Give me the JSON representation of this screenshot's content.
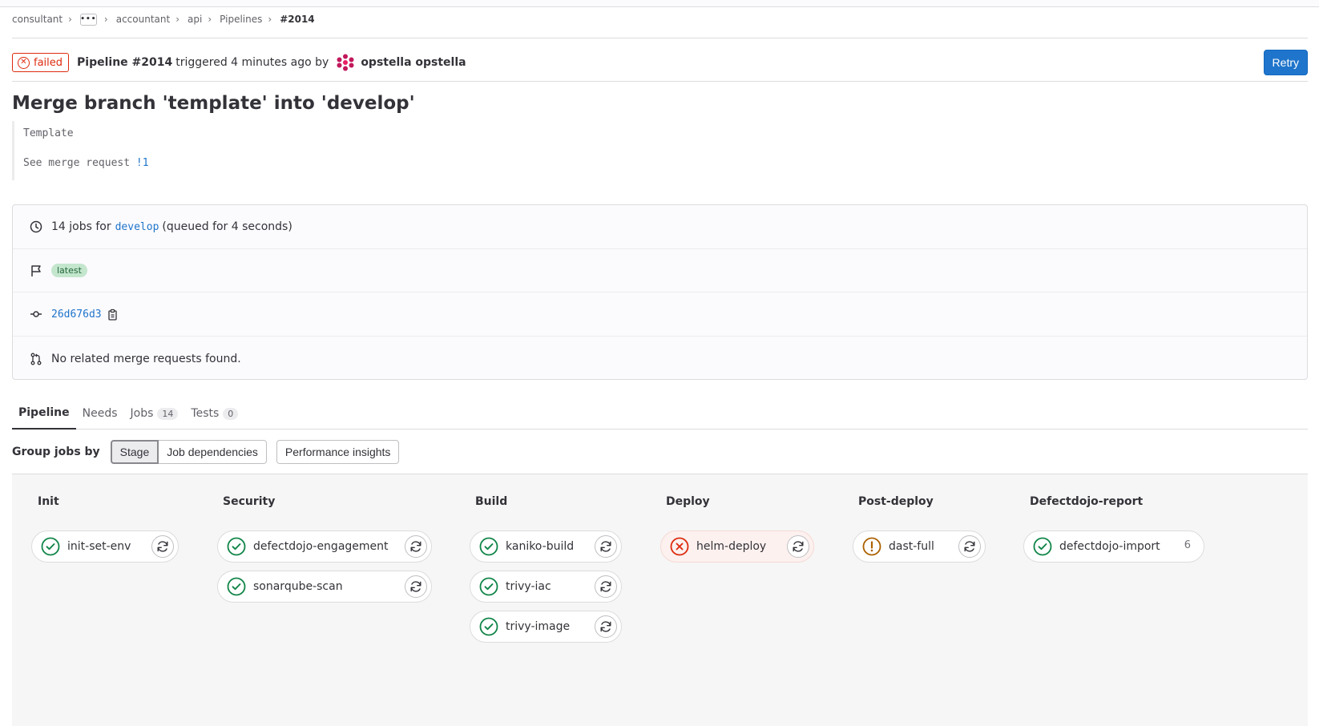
{
  "breadcrumbs": {
    "items": [
      "consultant",
      "accountant",
      "api",
      "Pipelines",
      "#2014"
    ],
    "ellipsis": "•••"
  },
  "header": {
    "status": "failed",
    "pipeline_label": "Pipeline #2014",
    "triggered_text": "triggered 4 minutes ago by",
    "user": "opstella opstella",
    "retry_label": "Retry"
  },
  "commit": {
    "title": "Merge branch 'template' into 'develop'",
    "desc_line1": "Template",
    "desc_line2_prefix": "See merge request ",
    "desc_line2_link": "!1"
  },
  "info": {
    "jobs_prefix": "14 jobs for",
    "branch": "develop",
    "queued": "(queued for 4 seconds)",
    "badge": "latest",
    "sha": "26d676d3",
    "mr_text": "No related merge requests found."
  },
  "tabs": [
    {
      "label": "Pipeline",
      "count": null
    },
    {
      "label": "Needs",
      "count": null
    },
    {
      "label": "Jobs",
      "count": "14"
    },
    {
      "label": "Tests",
      "count": "0"
    }
  ],
  "group_by": {
    "label": "Group jobs by",
    "options": [
      "Stage",
      "Job dependencies"
    ],
    "selected": "Stage",
    "performance": "Performance insights"
  },
  "stages": [
    {
      "name": "Init",
      "jobs": [
        {
          "name": "init-set-env",
          "status": "success"
        }
      ]
    },
    {
      "name": "Security",
      "jobs": [
        {
          "name": "defectdojo-engagement",
          "status": "success"
        },
        {
          "name": "sonarqube-scan",
          "status": "success"
        }
      ]
    },
    {
      "name": "Build",
      "jobs": [
        {
          "name": "kaniko-build",
          "status": "success"
        },
        {
          "name": "trivy-iac",
          "status": "success"
        },
        {
          "name": "trivy-image",
          "status": "success"
        }
      ]
    },
    {
      "name": "Deploy",
      "jobs": [
        {
          "name": "helm-deploy",
          "status": "failed"
        }
      ]
    },
    {
      "name": "Post-deploy",
      "jobs": [
        {
          "name": "dast-full",
          "status": "warning"
        }
      ]
    },
    {
      "name": "Defectdojo-report",
      "jobs": [
        {
          "name": "defectdojo-import",
          "status": "success",
          "count": "6"
        }
      ]
    }
  ],
  "colors": {
    "success": "#108548",
    "failed": "#dd2b0e",
    "warning": "#ab6100",
    "link": "#1f75cb",
    "primary_button": "#1f75cb"
  }
}
